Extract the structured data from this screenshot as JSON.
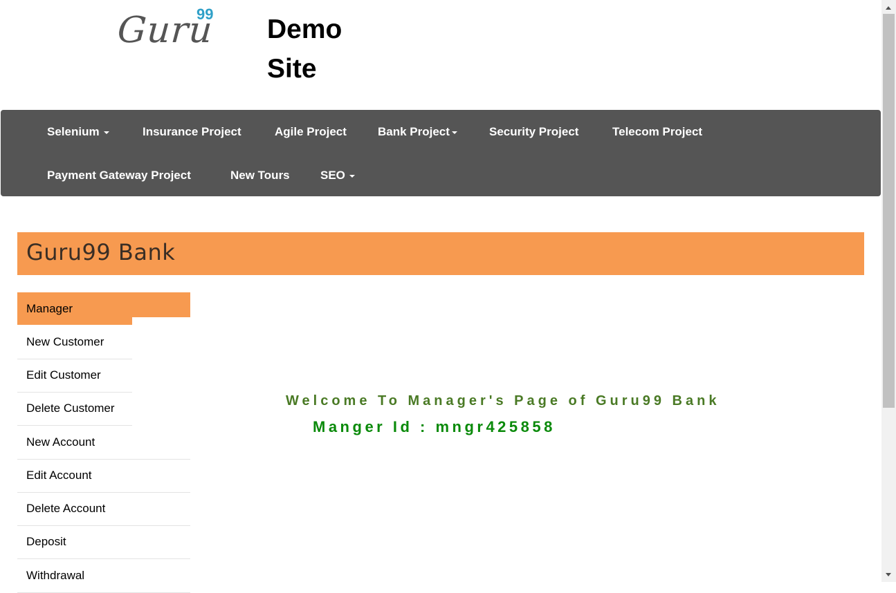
{
  "header": {
    "logo_text": "Guru",
    "logo_superscript": "99",
    "site_title": "Demo Site"
  },
  "navbar": {
    "items": [
      {
        "label": "Selenium",
        "dropdown": true
      },
      {
        "label": "Insurance Project",
        "dropdown": false
      },
      {
        "label": "Agile Project",
        "dropdown": false
      },
      {
        "label": "Bank Project",
        "dropdown": true
      },
      {
        "label": "Security Project",
        "dropdown": false
      },
      {
        "label": "Telecom Project",
        "dropdown": false
      },
      {
        "label": "Payment Gateway Project",
        "dropdown": false
      },
      {
        "label": "New Tours",
        "dropdown": false
      },
      {
        "label": "SEO",
        "dropdown": true
      }
    ]
  },
  "bank": {
    "title": "Guru99 Bank"
  },
  "menu": {
    "items": [
      {
        "label": "Manager",
        "active": true
      },
      {
        "label": "New Customer"
      },
      {
        "label": "Edit Customer"
      },
      {
        "label": "Delete Customer"
      },
      {
        "label": "New Account"
      },
      {
        "label": "Edit Account"
      },
      {
        "label": "Delete Account"
      },
      {
        "label": "Deposit"
      },
      {
        "label": "Withdrawal"
      }
    ]
  },
  "main": {
    "welcome": "Welcome To Manager's Page of Guru99 Bank",
    "manager_id": "Manger Id : mngr425858"
  },
  "colors": {
    "navbar_bg": "#555555",
    "accent_orange": "#f79a50",
    "welcome_green": "#4a7a25",
    "id_green": "#0a8a0a"
  }
}
